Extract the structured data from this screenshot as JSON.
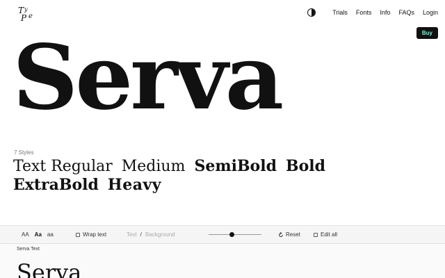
{
  "logo": {
    "text": "TYPE"
  },
  "nav": {
    "theme_icon": "half-circle-contrast-icon",
    "links": [
      "Trials",
      "Fonts",
      "Info",
      "FAQs",
      "Login"
    ]
  },
  "buy": {
    "label": "Buy",
    "bg": "#111111",
    "fg": "#7ff1da"
  },
  "hero": {
    "title": "Serva"
  },
  "styles": {
    "count": "7 Styles",
    "names": [
      "Text Regular",
      "Medium",
      "SemiBold",
      "Bold",
      "ExtraBold",
      "Heavy"
    ]
  },
  "toolbar": {
    "case_options": [
      "AA",
      "Aa",
      "aa"
    ],
    "case_selected": "Aa",
    "wrap_label": "Wrap text",
    "text_label": "Text",
    "separator": "/",
    "background_label": "Background",
    "reset_label": "Reset",
    "edit_all_label": "Edit all"
  },
  "preview": {
    "label": "Serva Text",
    "sample": "Serva"
  }
}
